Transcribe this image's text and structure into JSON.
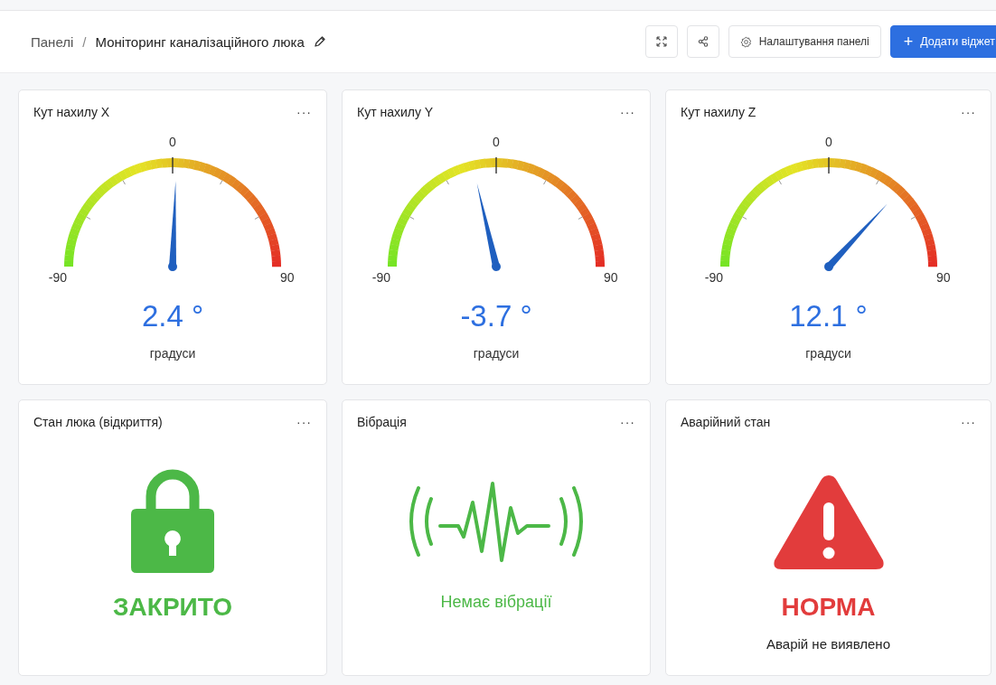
{
  "breadcrumb": {
    "root": "Панелі",
    "separator": "/",
    "current": "Моніторинг каналізаційного люка"
  },
  "toolbar": {
    "settings": "Налаштування панелі",
    "add": "Додати віджет",
    "add_icon": "+"
  },
  "widgets": [
    {
      "kind": "gauge",
      "title": "Кут нахилу X",
      "menu": "···",
      "min": "-90",
      "mid": "0",
      "max": "90",
      "value": "2.4 °",
      "unit": "градуси"
    },
    {
      "kind": "gauge",
      "title": "Кут нахилу Y",
      "menu": "···",
      "min": "-90",
      "mid": "0",
      "max": "90",
      "value": "-3.7 °",
      "unit": "градуси"
    },
    {
      "kind": "gauge",
      "title": "Кут нахилу Z",
      "menu": "···",
      "min": "-90",
      "mid": "0",
      "max": "90",
      "value": "12.1 °",
      "unit": "градуси"
    },
    {
      "kind": "lock",
      "title": "Стан люка (відкриття)",
      "menu": "···",
      "status": "ЗАКРИТО",
      "color": "#4cb847"
    },
    {
      "kind": "vibration",
      "title": "Вібрація",
      "menu": "···",
      "status": "Немає вібрації",
      "color": "#4cb847"
    },
    {
      "kind": "alarm",
      "title": "Аварійний стан",
      "menu": "···",
      "status": "НОРМА",
      "color": "#e23c3c",
      "note": "Аварій не виявлено"
    }
  ]
}
